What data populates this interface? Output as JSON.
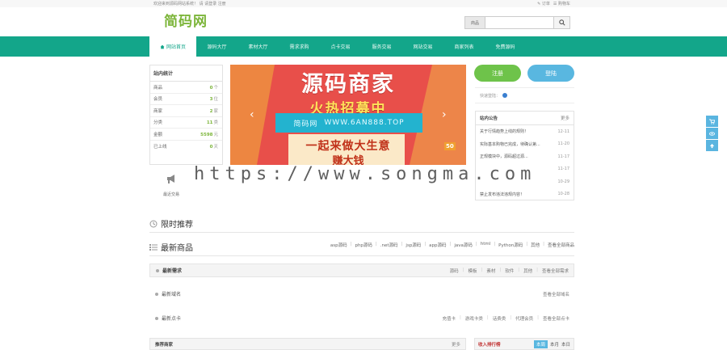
{
  "topbar": {
    "welcome": "欢迎来到源码网站系统！ 请 请登录 注册",
    "links": [
      "✎ 订单",
      "☰ 购物车"
    ]
  },
  "logo": "简码网",
  "search": {
    "scope": "商品",
    "placeholder": ""
  },
  "nav": {
    "items": [
      "网站首页",
      "源码大厅",
      "素材大厅",
      "需求求购",
      "点卡交易",
      "服务交易",
      "网站交易",
      "商家列表",
      "免费源码"
    ]
  },
  "stats": {
    "title": "站内统计",
    "rows": [
      {
        "label": "商品",
        "value": "0",
        "unit": "个"
      },
      {
        "label": "会员",
        "value": "3",
        "unit": "位"
      },
      {
        "label": "商家",
        "value": "2",
        "unit": "家"
      },
      {
        "label": "分类",
        "value": "11",
        "unit": "类"
      },
      {
        "label": "金额",
        "value": "5598",
        "unit": "元"
      },
      {
        "label": "已上线",
        "value": "0",
        "unit": "天"
      }
    ]
  },
  "trade_label": "最近交易",
  "banner": {
    "title": "源码商家",
    "subtitle": "火热招募中",
    "site": "简码网",
    "url": "WWW.6AN888.TOP",
    "slogan1": "一起来做大生意",
    "slogan2": "赚大钱",
    "badge": "50"
  },
  "watermark": "https://www.songma.com",
  "auth": {
    "register": "注册",
    "login": "登陆"
  },
  "quick_login": "快速登陆：",
  "notice": {
    "title": "站内公告",
    "more": "更多",
    "items": [
      {
        "text": "关于行情趋势上线的规则！",
        "date": "12-11"
      },
      {
        "text": "实际基本购物已完成，待确认第...",
        "date": "11-20"
      },
      {
        "text": "正规模块中，源码超过源...",
        "date": "11-17"
      },
      {
        "text": "",
        "date": "11-17"
      },
      {
        "text": "",
        "date": "10-29"
      },
      {
        "text": "禁止发布违法违规内容！",
        "date": "10-28"
      }
    ]
  },
  "sections": {
    "limited": "限时推荐",
    "newest": "最新商品",
    "newest_cats": [
      "asp源码",
      "php源码",
      ".net源码",
      "jsp源码",
      "app源码",
      "java源码",
      "html",
      "Python源码",
      "其他",
      "查看全部商品"
    ]
  },
  "demand_bar": {
    "title": "最新需求",
    "links": [
      "源码",
      "模板",
      "素材",
      "软件",
      "其他",
      "查看全部需求"
    ]
  },
  "domain_row": {
    "title": "最新域名",
    "links": [
      "查看全部域名"
    ]
  },
  "card_row": {
    "title": "最新点卡",
    "links": [
      "充值卡",
      "游戏卡类",
      "话费类",
      "代理会员",
      "查看全部点卡"
    ]
  },
  "bottom": {
    "recommend": "推荐商家",
    "recommend_more": "更多",
    "rank": "收入排行榜",
    "rank_tabs": [
      "本周",
      "本月",
      "本日"
    ]
  }
}
